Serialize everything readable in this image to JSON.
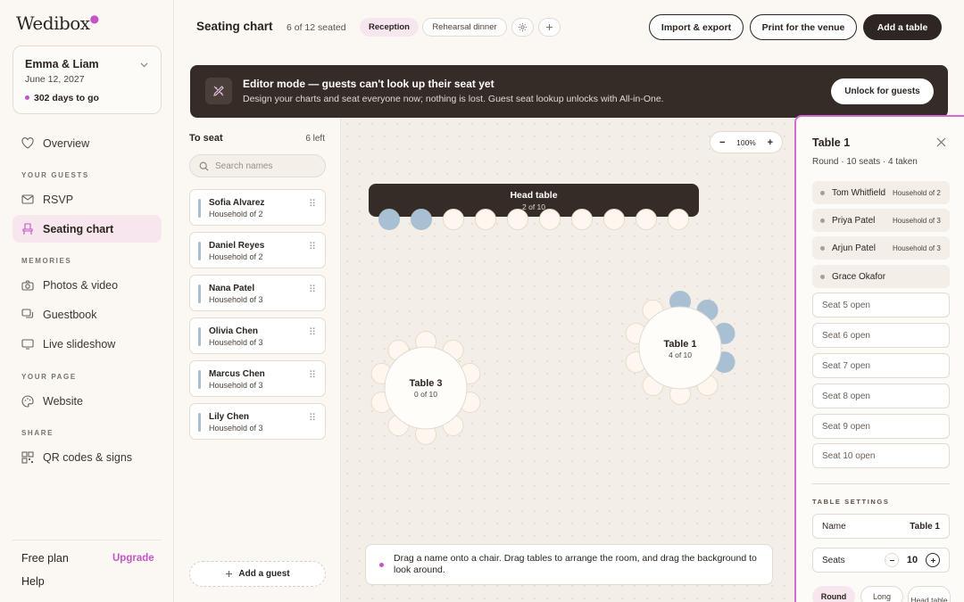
{
  "sidebar": {
    "logo": "Wedibox",
    "event": {
      "name": "Emma & Liam",
      "date": "June 12, 2027",
      "countdown": "302 days to go"
    },
    "nav": {
      "overview": "Overview",
      "section_guests": "YOUR GUESTS",
      "rsvp": "RSVP",
      "seating": "Seating chart",
      "section_memories": "MEMORIES",
      "photos": "Photos & video",
      "guestbook": "Guestbook",
      "slideshow": "Live slideshow",
      "section_page": "YOUR PAGE",
      "website": "Website",
      "section_share": "SHARE",
      "qr": "QR codes & signs"
    },
    "footer": {
      "plan": "Free plan",
      "upgrade": "Upgrade",
      "help": "Help"
    }
  },
  "topbar": {
    "title": "Seating chart",
    "seated": "6 of 12 seated",
    "tabs": [
      "Reception",
      "Rehearsal dinner"
    ],
    "active_tab": "Reception",
    "import_label": "Import & export",
    "print_label": "Print for the venue",
    "add_table_label": "Add a table"
  },
  "banner": {
    "title": "Editor mode — guests can't look up their seat yet",
    "subtitle": "Design your charts and seat everyone now; nothing is lost. Guest seat lookup unlocks with All-in-One.",
    "button": "Unlock for guests"
  },
  "to_seat": {
    "title": "To seat",
    "remaining": "6 left",
    "search_placeholder": "Search names",
    "guests": [
      {
        "name": "Sofia Alvarez",
        "household": "Household of 2"
      },
      {
        "name": "Daniel Reyes",
        "household": "Household of 2"
      },
      {
        "name": "Nana Patel",
        "household": "Household of 3"
      },
      {
        "name": "Olivia Chen",
        "household": "Household of 3"
      },
      {
        "name": "Marcus Chen",
        "household": "Household of 3"
      },
      {
        "name": "Lily Chen",
        "household": "Household of 3"
      }
    ],
    "add_guest": "Add a guest"
  },
  "canvas": {
    "zoom_minus": "−",
    "zoom_level": "100%",
    "zoom_plus": "+",
    "tables": [
      {
        "id": "head",
        "name": "Head table",
        "count": "2 of 10",
        "seats": 10,
        "filled": 2
      },
      {
        "id": "t1",
        "name": "Table 1",
        "count": "4 of 10",
        "seats": 10,
        "filled": 4
      },
      {
        "id": "t3",
        "name": "Table 3",
        "count": "0 of 10",
        "seats": 10,
        "filled": 0
      }
    ],
    "hint": "Drag a name onto a chair. Drag tables to arrange the room, and drag the background to look around."
  },
  "colors": {
    "accent": "#c455c8",
    "seat_filled": "#a8c0d2",
    "seat_empty": "#fdf7ef"
  },
  "panel": {
    "title": "Table 1",
    "subtitle": "Round · 10 seats · 4 taken",
    "taken": [
      {
        "name": "Tom Whitfield",
        "household": "Household of 2"
      },
      {
        "name": "Priya Patel",
        "household": "Household of 3"
      },
      {
        "name": "Arjun Patel",
        "household": "Household of 3"
      },
      {
        "name": "Grace Okafor",
        "household": ""
      }
    ],
    "open_seats": [
      "Seat 5 open",
      "Seat 6 open",
      "Seat 7 open",
      "Seat 8 open",
      "Seat 9 open",
      "Seat 10 open"
    ],
    "settings_title": "TABLE SETTINGS",
    "name_label": "Name",
    "name_value": "Table 1",
    "seats_label": "Seats",
    "seats_value": "10",
    "shapes": [
      "Round",
      "Long",
      "Head table"
    ],
    "active_shape": "Round"
  }
}
